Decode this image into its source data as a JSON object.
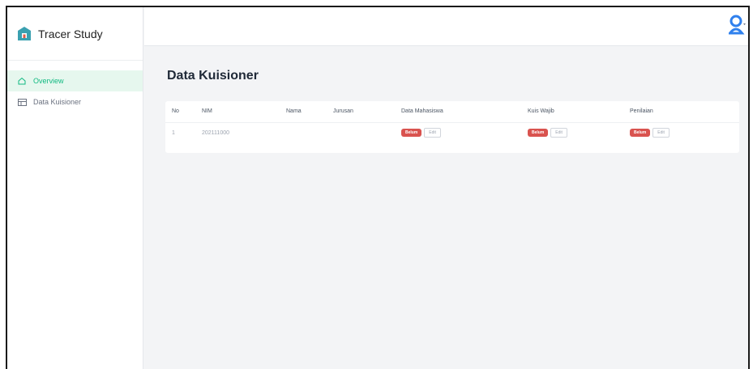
{
  "app": {
    "title": "Tracer Study"
  },
  "sidebar": {
    "items": [
      {
        "label": "Overview",
        "icon": "home-icon",
        "active": true
      },
      {
        "label": "Data Kuisioner",
        "icon": "table-icon",
        "active": false
      }
    ]
  },
  "colors": {
    "accent": "#10b981",
    "badge": "#d9534f",
    "logo": "#3aa0b0",
    "user": "#2f80ed"
  },
  "main": {
    "title": "Data Kuisioner",
    "table": {
      "headers": [
        "No",
        "NIM",
        "Nama",
        "Jurusan",
        "Data Mahasiswa",
        "Kuis Wajib",
        "Penilaian"
      ],
      "rows": [
        {
          "no": "1",
          "nim": "202111000",
          "nama": "",
          "jurusan": "",
          "data_mahasiswa": {
            "badge": "Belum",
            "edit": "Edit"
          },
          "kuis_wajib": {
            "badge": "Belum",
            "edit": "Edit"
          },
          "penilaian": {
            "badge": "Belum",
            "edit": "Edit"
          }
        }
      ]
    }
  }
}
